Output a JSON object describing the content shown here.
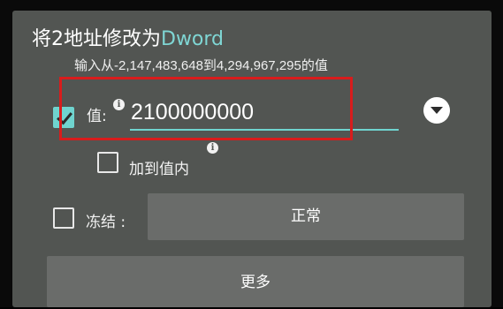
{
  "dialog": {
    "title_prefix": "将2地址修改为",
    "title_type": "Dword",
    "hint": "输入从-2,147,483,648到4,294,967,295的值"
  },
  "value_row": {
    "label": "值:",
    "value": "2100000000",
    "checked": true,
    "info_icon": "info-icon",
    "dropdown_icon": "chevron-down-circle-icon"
  },
  "add_to_value": {
    "label": "加到值内",
    "checked": false
  },
  "freeze_row": {
    "label": "冻结 :",
    "checked": false,
    "mode_button": "正常"
  },
  "more_button": "更多",
  "colors": {
    "dialog_bg": "#525552",
    "accent": "#6fd4cf",
    "highlight": "#d81c1c"
  }
}
